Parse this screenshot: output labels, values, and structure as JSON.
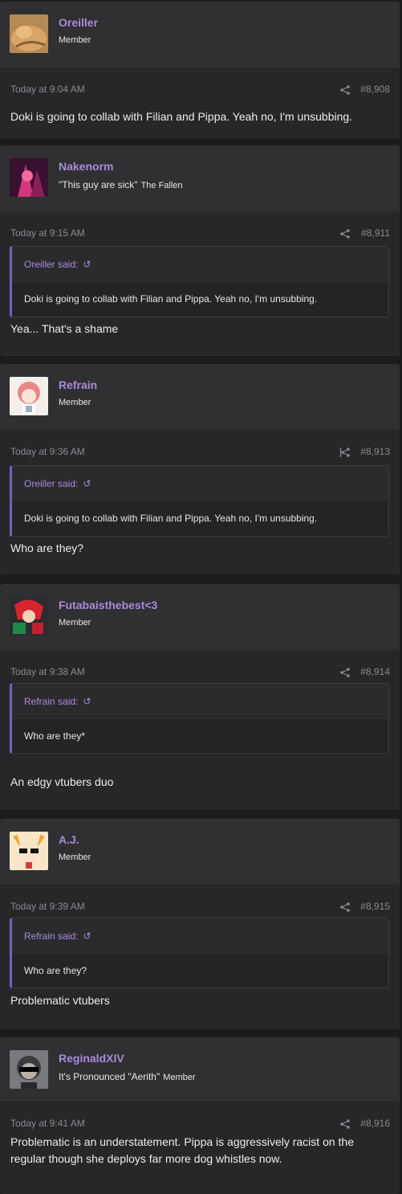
{
  "posts": [
    {
      "username": "Oreiller",
      "role": "Member",
      "title": "",
      "time": "Today at 9:04 AM",
      "number": "#8,908",
      "quote": null,
      "message": "Doki is going to collab with Filian and Pippa. Yeah no, I'm unsubbing.",
      "avatar_icon": "cat-avatar"
    },
    {
      "username": "Nakenorm",
      "role": "The Fallen",
      "title": "\"This guy are sick\"",
      "time": "Today at 9:15 AM",
      "number": "#8,911",
      "quote": {
        "author": "Oreiller said:",
        "text": "Doki is going to collab with Filian and Pippa. Yeah no, I'm unsubbing."
      },
      "message": "Yea... That's a shame",
      "avatar_icon": "pink-character-avatar"
    },
    {
      "username": "Refrain",
      "role": "Member",
      "title": "",
      "time": "Today at 9:36 AM",
      "number": "#8,913",
      "quote": {
        "author": "Oreiller said:",
        "text": "Doki is going to collab with Filian and Pippa. Yeah no, I'm unsubbing."
      },
      "message": "Who are they?",
      "avatar_icon": "anime-girl-avatar"
    },
    {
      "username": "Futabaisthebest<3",
      "role": "Member",
      "title": "",
      "time": "Today at 9:38 AM",
      "number": "#8,914",
      "quote": {
        "author": "Refrain said:",
        "text": "Who are they*"
      },
      "message": "An edgy vtubers duo",
      "avatar_icon": "red-hair-avatar"
    },
    {
      "username": "A.J.",
      "role": "Member",
      "title": "",
      "time": "Today at 9:39 AM",
      "number": "#8,915",
      "quote": {
        "author": "Refrain said:",
        "text": "Who are they?"
      },
      "message": "Problematic vtubers",
      "avatar_icon": "sunglasses-character-avatar"
    },
    {
      "username": "ReginaldXIV",
      "role": "Member",
      "title": "It's Pronounced \"Aerith\"",
      "time": "Today at 9:41 AM",
      "number": "#8,916",
      "quote": null,
      "message": "Problematic is an understatement. Pippa is aggressively racist on the regular though she deploys far more dog whistles now.",
      "avatar_icon": "censored-face-avatar"
    }
  ],
  "colors": {
    "username": "#a98adb",
    "quote_border": "#7a5cc0",
    "background": "#1b1b1e"
  }
}
